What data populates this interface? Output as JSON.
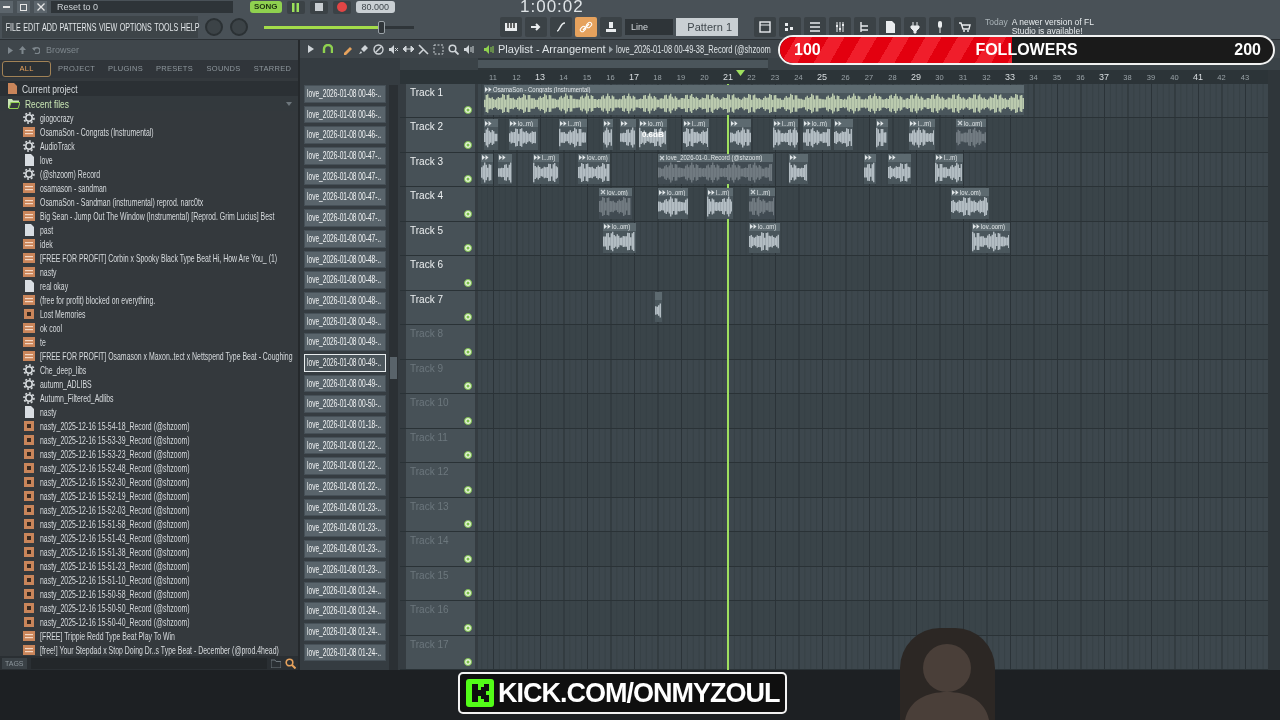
{
  "window": {
    "hint": "Reset to 0"
  },
  "transport": {
    "mode": "SONG",
    "playing": true,
    "tempo": "80.000",
    "time": "1:00:02"
  },
  "menu": [
    "FILE",
    "EDIT",
    "ADD",
    "PATTERNS",
    "VIEW",
    "OPTIONS",
    "TOOLS",
    "HELP"
  ],
  "master_volume": {
    "level": 0.78
  },
  "toolbar": {
    "snap": "Line",
    "pattern": "Pattern 1",
    "news": {
      "label": "Today",
      "text": "A newer version of FL Studio is available!"
    }
  },
  "browser": {
    "title": "Browser",
    "tabs": [
      {
        "label": "ALL",
        "selected": true
      },
      {
        "label": "PROJECT",
        "selected": false
      },
      {
        "label": "PLUGINS",
        "selected": false
      },
      {
        "label": "PRESETS",
        "selected": false
      },
      {
        "label": "SOUNDS",
        "selected": false
      },
      {
        "label": "STARRED",
        "selected": false
      }
    ],
    "tree": [
      {
        "label": "Current project",
        "kind": "project",
        "expanded": false
      },
      {
        "label": "Recent files",
        "kind": "recent",
        "expanded": true,
        "children": [
          {
            "label": "giogocrazy",
            "kind": "gear"
          },
          {
            "label": "OsamaSon - Congrats (Instrumental)",
            "kind": "mp3"
          },
          {
            "label": "AudioTrack",
            "kind": "gear"
          },
          {
            "label": "love",
            "kind": "page"
          },
          {
            "label": "(@shzoom) Record",
            "kind": "gear"
          },
          {
            "label": "osamason - sandman",
            "kind": "mp3"
          },
          {
            "label": "OsamaSon - Sandman (instrumental) reprod. narc0tx",
            "kind": "mp3"
          },
          {
            "label": "Big Sean - Jump Out The Window (Instrumental) [Reprod. Grim Lucius] Best",
            "kind": "mp3"
          },
          {
            "label": "past",
            "kind": "page"
          },
          {
            "label": "idek",
            "kind": "mp3"
          },
          {
            "label": "[FREE FOR PROFIT] Corbin x Spooky Black Type Beat Hi, How Are You_ (1)",
            "kind": "mp3"
          },
          {
            "label": "nasty",
            "kind": "mp3"
          },
          {
            "label": "real okay",
            "kind": "page"
          },
          {
            "label": "(free for profit) blocked on everything.",
            "kind": "mp3"
          },
          {
            "label": "Lost Memories",
            "kind": "wave"
          },
          {
            "label": "ok cool",
            "kind": "mp3"
          },
          {
            "label": "te",
            "kind": "mp3"
          },
          {
            "label": "[FREE FOR PROFIT] Osamason x Maxon..tect x Nettspend Type Beat - Coughing",
            "kind": "mp3"
          },
          {
            "label": "Che_deep_libs",
            "kind": "gear"
          },
          {
            "label": "autumn_ADLIBS",
            "kind": "gear"
          },
          {
            "label": "Autumn_Filtered_Adlibs",
            "kind": "gear"
          },
          {
            "label": "nasty",
            "kind": "page"
          },
          {
            "label": "nasty_2025-12-16 15-54-18_Record (@shzoom)",
            "kind": "wave"
          },
          {
            "label": "nasty_2025-12-16 15-53-39_Record (@shzoom)",
            "kind": "wave"
          },
          {
            "label": "nasty_2025-12-16 15-53-23_Record (@shzoom)",
            "kind": "wave"
          },
          {
            "label": "nasty_2025-12-16 15-52-48_Record (@shzoom)",
            "kind": "wave"
          },
          {
            "label": "nasty_2025-12-16 15-52-30_Record (@shzoom)",
            "kind": "wave"
          },
          {
            "label": "nasty_2025-12-16 15-52-19_Record (@shzoom)",
            "kind": "wave"
          },
          {
            "label": "nasty_2025-12-16 15-52-03_Record (@shzoom)",
            "kind": "wave"
          },
          {
            "label": "nasty_2025-12-16 15-51-58_Record (@shzoom)",
            "kind": "wave"
          },
          {
            "label": "nasty_2025-12-16 15-51-43_Record (@shzoom)",
            "kind": "wave"
          },
          {
            "label": "nasty_2025-12-16 15-51-38_Record (@shzoom)",
            "kind": "wave"
          },
          {
            "label": "nasty_2025-12-16 15-51-23_Record (@shzoom)",
            "kind": "wave"
          },
          {
            "label": "nasty_2025-12-16 15-51-10_Record (@shzoom)",
            "kind": "wave"
          },
          {
            "label": "nasty_2025-12-16 15-50-58_Record (@shzoom)",
            "kind": "wave"
          },
          {
            "label": "nasty_2025-12-16 15-50-50_Record (@shzoom)",
            "kind": "wave"
          },
          {
            "label": "nasty_2025-12-16 15-50-40_Record (@shzoom)",
            "kind": "wave"
          },
          {
            "label": "[FREE] Trippie Redd Type Beat Play To Win",
            "kind": "mp3"
          },
          {
            "label": "[free!] Your Stepdad x Stop Doing Dr..s Type Beat - December (@prod.4head)",
            "kind": "mp3"
          }
        ]
      }
    ],
    "tags_label": "TAGS"
  },
  "clips_panel": {
    "items": [
      {
        "label": "love_2026-01-08 00-46-..",
        "selected": false
      },
      {
        "label": "love_2026-01-08 00-46-..",
        "selected": false
      },
      {
        "label": "love_2026-01-08 00-46-..",
        "selected": false
      },
      {
        "label": "love_2026-01-08 00-47-..",
        "selected": false
      },
      {
        "label": "love_2026-01-08 00-47-..",
        "selected": false
      },
      {
        "label": "love_2026-01-08 00-47-..",
        "selected": false
      },
      {
        "label": "love_2026-01-08 00-47-..",
        "selected": false
      },
      {
        "label": "love_2026-01-08 00-47-..",
        "selected": false
      },
      {
        "label": "love_2026-01-08 00-48-..",
        "selected": false
      },
      {
        "label": "love_2026-01-08 00-48-..",
        "selected": false
      },
      {
        "label": "love_2026-01-08 00-48-..",
        "selected": false
      },
      {
        "label": "love_2026-01-08 00-49-..",
        "selected": false
      },
      {
        "label": "love_2026-01-08 00-49-..",
        "selected": false
      },
      {
        "label": "love_2026-01-08 00-49-..",
        "selected": true
      },
      {
        "label": "love_2026-01-08 00-49-..",
        "selected": false
      },
      {
        "label": "love_2026-01-08 00-50-..",
        "selected": false
      },
      {
        "label": "love_2026-01-08 01-18-..",
        "selected": false
      },
      {
        "label": "love_2026-01-08 01-22-..",
        "selected": false
      },
      {
        "label": "love_2026-01-08 01-22-..",
        "selected": false
      },
      {
        "label": "love_2026-01-08 01-22-..",
        "selected": false
      },
      {
        "label": "love_2026-01-08 01-23-..",
        "selected": false
      },
      {
        "label": "love_2026-01-08 01-23-..",
        "selected": false
      },
      {
        "label": "love_2026-01-08 01-23-..",
        "selected": false
      },
      {
        "label": "love_2026-01-08 01-23-..",
        "selected": false
      },
      {
        "label": "love_2026-01-08 01-24-..",
        "selected": false
      },
      {
        "label": "love_2026-01-08 01-24-..",
        "selected": false
      },
      {
        "label": "love_2026-01-08 01-24-..",
        "selected": false
      },
      {
        "label": "love_2026-01-08 01-24-..",
        "selected": false
      }
    ]
  },
  "playlist": {
    "title": "Playlist - Arrangement",
    "breadcrumb": "love_2026-01-08 00-49-38_Record (@shzoom",
    "ruler": [
      "11",
      "12",
      "13",
      "14",
      "15",
      "16",
      "17",
      "18",
      "19",
      "20",
      "21",
      "22",
      "23",
      "24",
      "25",
      "26",
      "27",
      "28",
      "29",
      "30",
      "31",
      "32",
      "33",
      "34",
      "35",
      "36",
      "37",
      "38",
      "39",
      "40",
      "41",
      "42",
      "43"
    ],
    "tracks": [
      {
        "name": "Track 1",
        "empty": false,
        "clips": [
          {
            "label": "OsamaSon - Congrats (Instrumental)",
            "muted": false
          }
        ]
      },
      {
        "name": "Track 2",
        "empty": false,
        "clips": [
          {
            "muted": false
          },
          {
            "label": "lo..m)",
            "muted": false
          },
          {
            "label": "l...m)",
            "muted": false
          },
          {
            "muted": false
          },
          {
            "muted": false
          },
          {
            "label": "lo..m)",
            "muted": false,
            "gain": "0.6dB"
          },
          {
            "label": "l...m)",
            "muted": false
          },
          {
            "muted": false
          },
          {
            "label": "l...m)",
            "muted": false
          },
          {
            "label": "lo..m)",
            "muted": false
          },
          {
            "muted": false
          },
          {
            "muted": false
          },
          {
            "label": "l...m)",
            "muted": false
          },
          {
            "label": "lo..om)",
            "muted": true
          }
        ]
      },
      {
        "name": "Track 3",
        "empty": false,
        "clips": [
          {
            "muted": false
          },
          {
            "muted": false
          },
          {
            "label": "l...m)",
            "muted": false
          },
          {
            "label": "lov..om)",
            "muted": false
          },
          {
            "label": "love_2026-01-0..Record (@shzoom)",
            "muted": true
          },
          {
            "muted": false
          },
          {
            "muted": false
          },
          {
            "muted": false
          },
          {
            "label": "l...m)",
            "muted": false
          }
        ]
      },
      {
        "name": "Track 4",
        "empty": false,
        "clips": [
          {
            "label": "lov..om)",
            "muted": true
          },
          {
            "label": "lo..om)",
            "muted": false
          },
          {
            "label": "l...m)",
            "muted": false
          },
          {
            "label": "l...m)",
            "muted": true
          },
          {
            "label": "lov..om)",
            "muted": false
          }
        ]
      },
      {
        "name": "Track 5",
        "empty": false,
        "clips": [
          {
            "label": "lo..om)",
            "muted": false
          },
          {
            "label": "lo..om)",
            "muted": false
          },
          {
            "label": "lov..oom)",
            "muted": false
          }
        ]
      },
      {
        "name": "Track 6",
        "empty": false
      },
      {
        "name": "Track 7",
        "empty": false,
        "clips": [
          {
            "muted": false
          }
        ]
      },
      {
        "name": "Track 8",
        "empty": true
      },
      {
        "name": "Track 9",
        "empty": true
      },
      {
        "name": "Track 10",
        "empty": true
      },
      {
        "name": "Track 11",
        "empty": true
      },
      {
        "name": "Track 12",
        "empty": true
      },
      {
        "name": "Track 13",
        "empty": true
      },
      {
        "name": "Track 14",
        "empty": true
      },
      {
        "name": "Track 15",
        "empty": true
      },
      {
        "name": "Track 16",
        "empty": true
      },
      {
        "name": "Track 17",
        "empty": true
      }
    ]
  },
  "overlay": {
    "goal": {
      "start": "100",
      "label": "FOLLOWERS",
      "end": "200",
      "level": 0.47
    },
    "banner": "KICK.COM/ONMYZOUL"
  }
}
